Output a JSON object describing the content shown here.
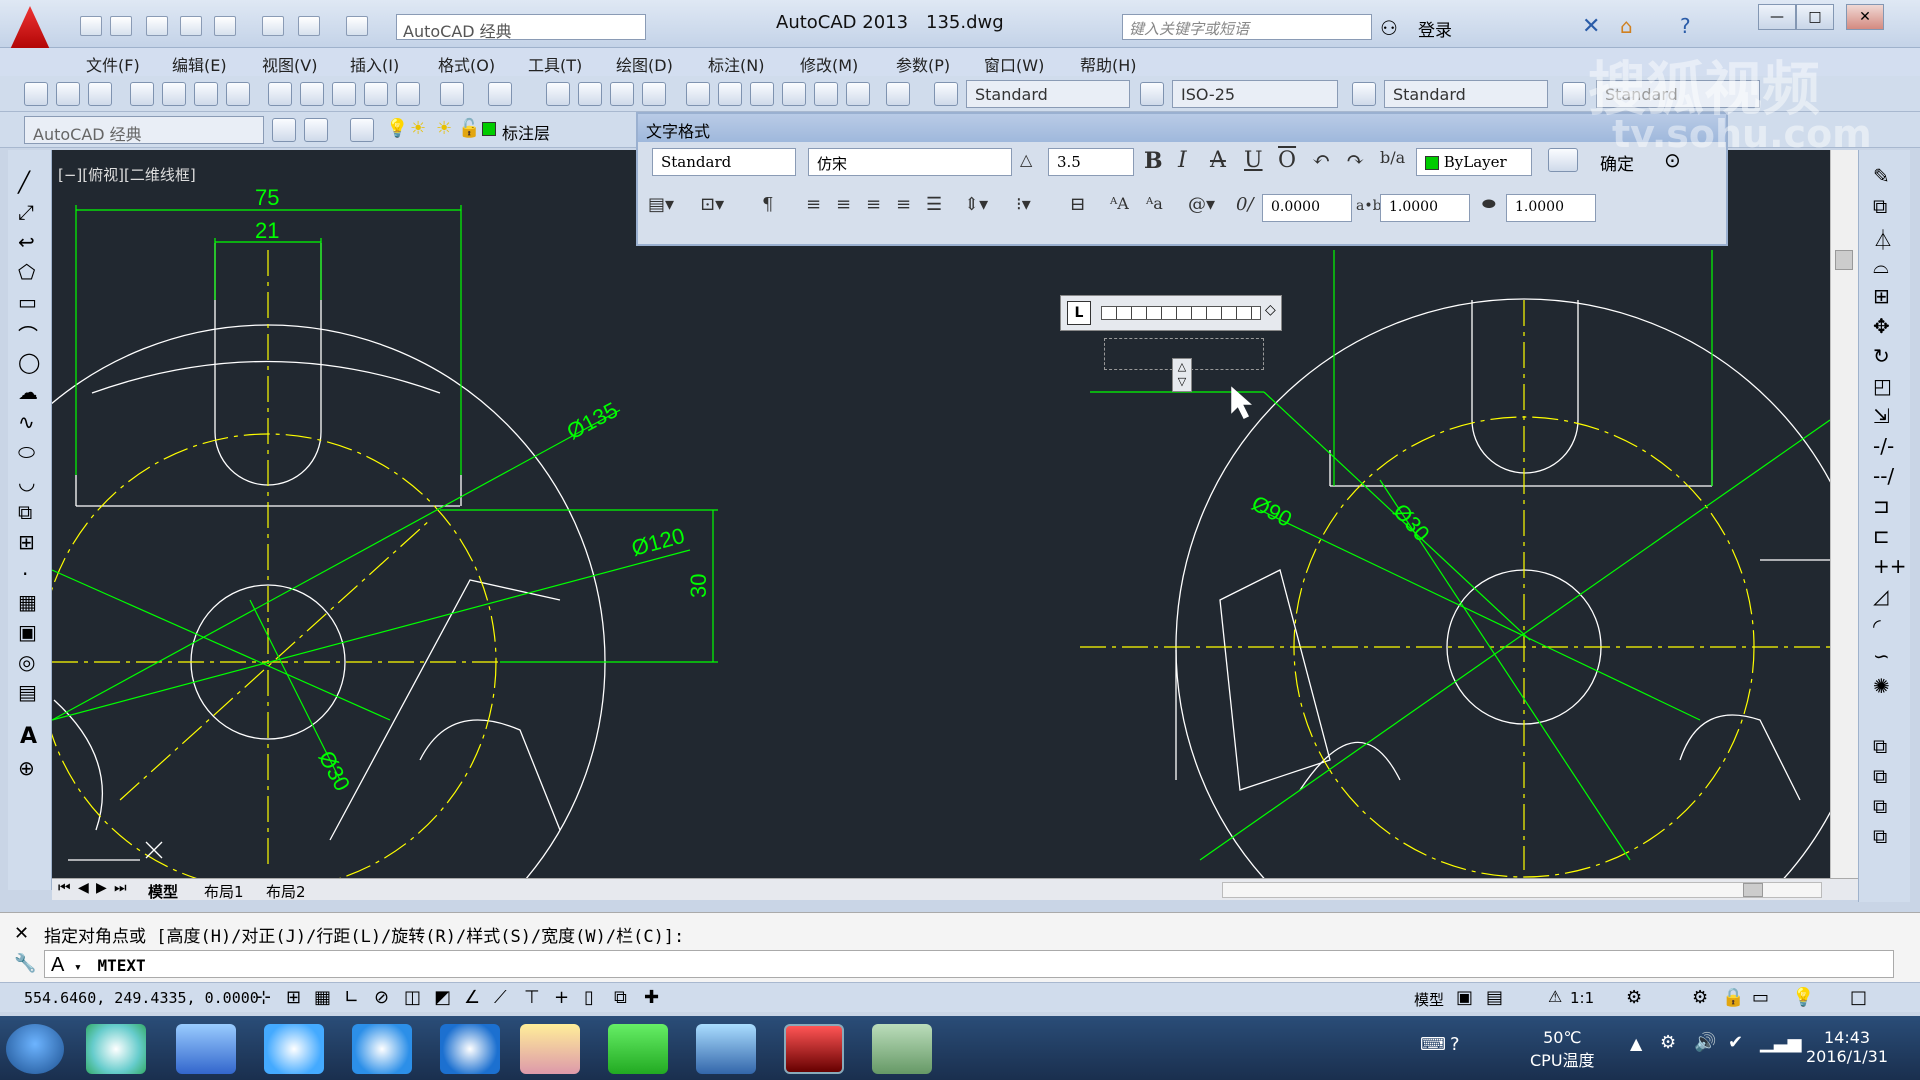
{
  "title_bar": {
    "workspace": "AutoCAD 经典",
    "app_title": "AutoCAD 2013",
    "file_name": "135.dwg",
    "search_placeholder": "键入关键字或短语",
    "login": "登录"
  },
  "menu": [
    "文件(F)",
    "编辑(E)",
    "视图(V)",
    "插入(I)",
    "格式(O)",
    "工具(T)",
    "绘图(D)",
    "标注(N)",
    "修改(M)",
    "参数(P)",
    "窗口(W)",
    "帮助(H)"
  ],
  "toolbar": {
    "text_style": "Standard",
    "dim_style": "ISO-25",
    "table_style": "Standard",
    "multileader_style": "Standard",
    "workspace": "AutoCAD 经典",
    "layer": "标注层"
  },
  "viewport_label": "[−][俯视][二维线框]",
  "text_format": {
    "title": "文字格式",
    "style": "Standard",
    "font": "仿宋",
    "height": "3.5",
    "color": "ByLayer",
    "ok": "确定",
    "oblique": "0.0000",
    "tracking": "1.0000",
    "width_factor": "1.0000"
  },
  "dimensions": {
    "d75": "75",
    "d21": "21",
    "d135": "Ø135",
    "d120": "Ø120",
    "d30v": "30",
    "d30": "Ø30",
    "d90": "Ø90",
    "d30r": "Ø30"
  },
  "tabs": [
    "模型",
    "布局1",
    "布局2"
  ],
  "command": {
    "prompt": "指定对角点或 [高度(H)/对正(J)/行距(L)/旋转(R)/样式(S)/宽度(W)/栏(C)]:",
    "input": "MTEXT"
  },
  "status": {
    "coords": "554.6460, 249.4335, 0.0000",
    "model": "模型",
    "scale": "1:1"
  },
  "taskbar": {
    "cpu_temp": "50℃",
    "cpu_label": "CPU温度",
    "time": "14:43",
    "date": "2016/1/31"
  },
  "watermark": {
    "line1": "搜狐视频",
    "line2": "tv.sohu.com"
  },
  "colors": {
    "canvas": "#212830",
    "dim_green": "#00ff00",
    "center_yellow": "#ffff00",
    "geometry_white": "#ffffff"
  }
}
